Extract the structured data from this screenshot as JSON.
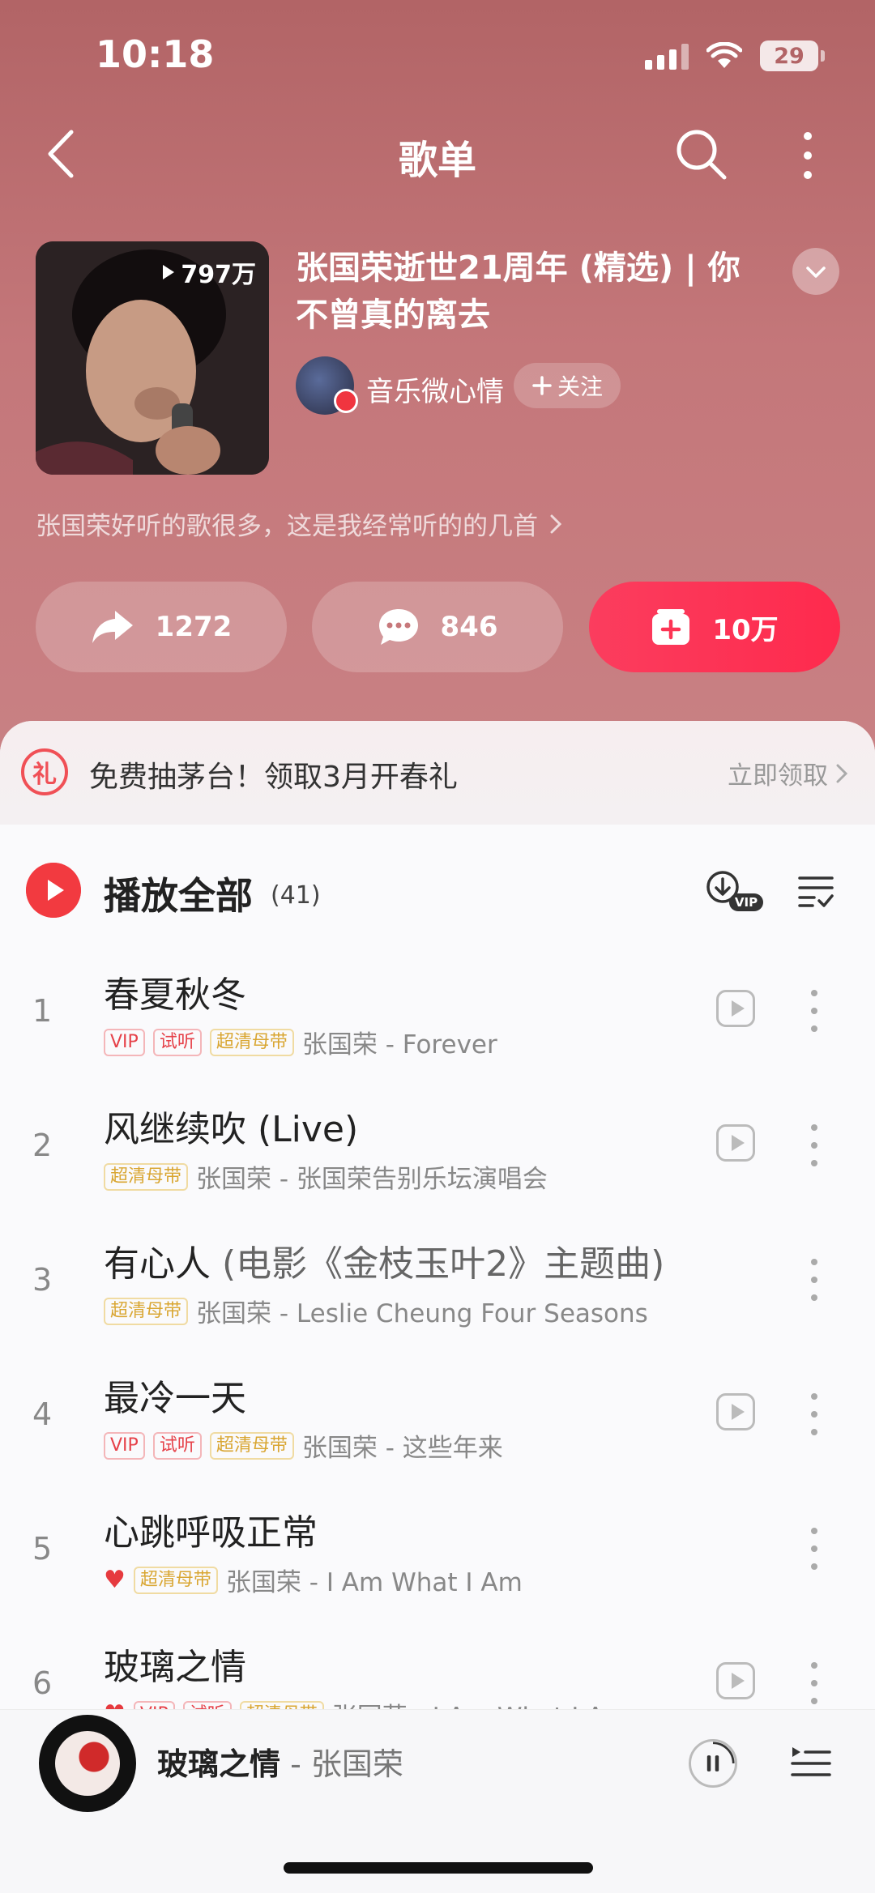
{
  "status_bar": {
    "time": "10:18",
    "battery": "29"
  },
  "nav": {
    "title": "歌单"
  },
  "playlist": {
    "play_count": "797万",
    "title": "张国荣逝世21周年 (精选) | 你不曾真的离去",
    "creator": "音乐微心情",
    "follow_label": "关注",
    "description": "张国荣好听的歌很多，这是我经常听的的几首"
  },
  "actions": {
    "share": "1272",
    "comment": "846",
    "collect": "10万"
  },
  "promo": {
    "text": "免费抽茅台！领取3月开春礼",
    "link": "立即领取",
    "icon_text": "礼"
  },
  "list_header": {
    "play_all": "播放全部",
    "count": "(41)"
  },
  "songs": [
    {
      "num": "1",
      "title": "春夏秋冬",
      "subtitle": "",
      "tags": [
        "VIP",
        "试听",
        "超清母带"
      ],
      "heart": false,
      "artist_album": "张国荣 - Forever",
      "has_play": true
    },
    {
      "num": "2",
      "title": "风继续吹 (Live)",
      "subtitle": "",
      "tags": [
        "超清母带"
      ],
      "heart": false,
      "artist_album": "张国荣 - 张国荣告别乐坛演唱会",
      "has_play": true
    },
    {
      "num": "3",
      "title": "有心人",
      "subtitle": " (电影《金枝玉叶2》主题曲)",
      "tags": [
        "超清母带"
      ],
      "heart": false,
      "artist_album": "张国荣 - Leslie Cheung Four Seasons",
      "has_play": false
    },
    {
      "num": "4",
      "title": "最冷一天",
      "subtitle": "",
      "tags": [
        "VIP",
        "试听",
        "超清母带"
      ],
      "heart": false,
      "artist_album": "张国荣 - 这些年来",
      "has_play": true
    },
    {
      "num": "5",
      "title": "心跳呼吸正常",
      "subtitle": "",
      "tags": [
        "超清母带"
      ],
      "heart": true,
      "artist_album": "张国荣 - I Am What I Am",
      "has_play": false
    },
    {
      "num": "6",
      "title": "玻璃之情",
      "subtitle": "",
      "tags": [
        "VIP",
        "试听",
        "超清母带"
      ],
      "heart": true,
      "artist_album": "张国荣 - I Am What I Am",
      "has_play": true
    }
  ],
  "mini_player": {
    "title": "玻璃之情",
    "artist": " - 张国荣"
  },
  "colors": {
    "accent": "#f23a40",
    "hero": "#c4777a",
    "collect_btn": "#fe2a4d"
  }
}
